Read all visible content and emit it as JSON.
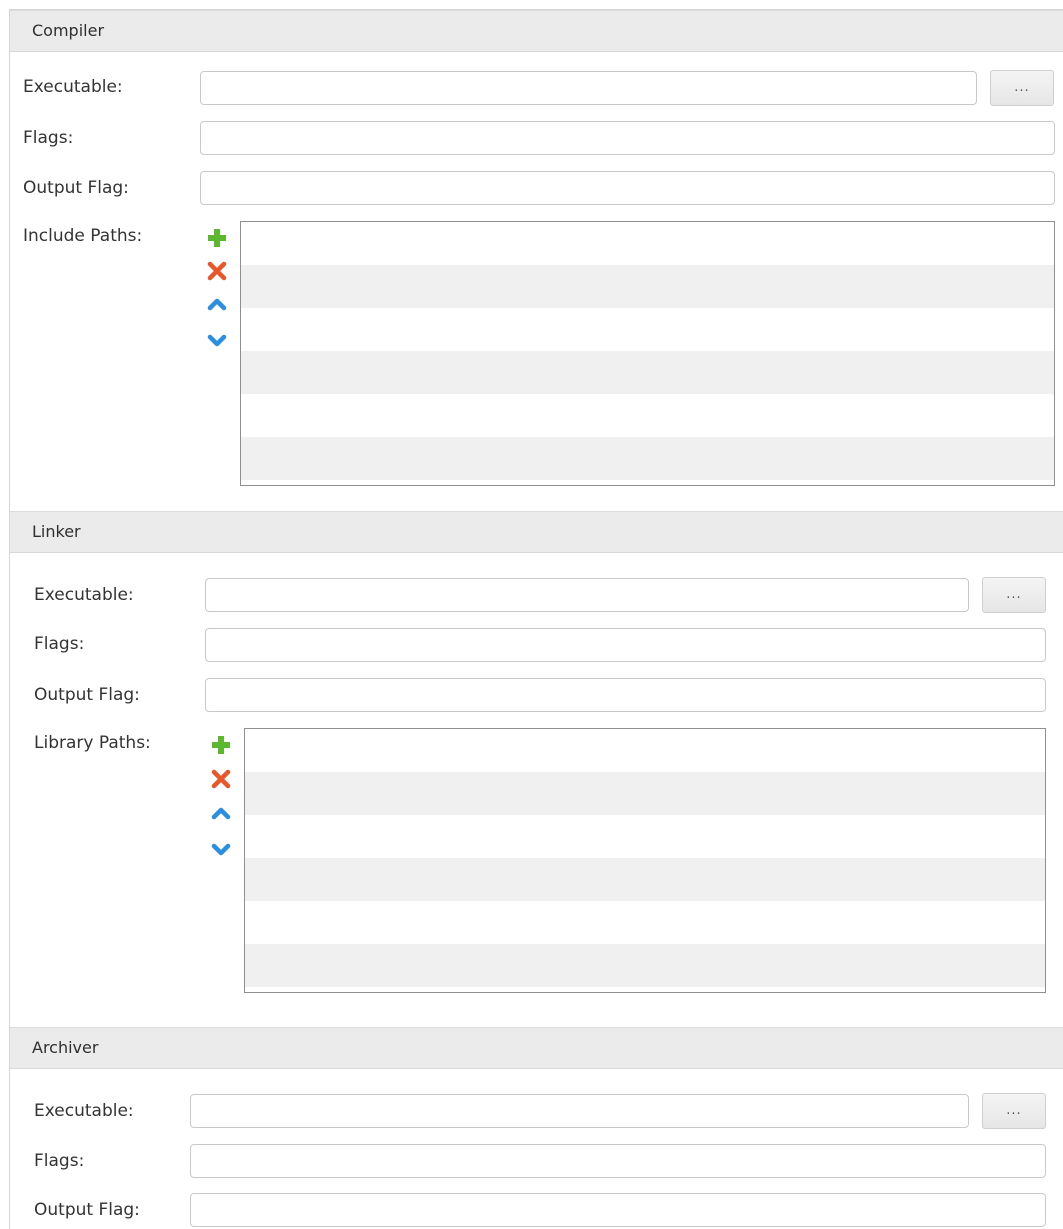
{
  "sections": {
    "compiler": {
      "title": "Compiler",
      "executable_label": "Executable:",
      "executable_value": "",
      "flags_label": "Flags:",
      "flags_value": "",
      "output_flag_label": "Output Flag:",
      "output_flag_value": "",
      "paths_label": "Include Paths:",
      "browse_label": "..."
    },
    "linker": {
      "title": "Linker",
      "executable_label": "Executable:",
      "executable_value": "",
      "flags_label": "Flags:",
      "flags_value": "",
      "output_flag_label": "Output Flag:",
      "output_flag_value": "",
      "paths_label": "Library Paths:",
      "browse_label": "..."
    },
    "archiver": {
      "title": "Archiver",
      "executable_label": "Executable:",
      "executable_value": "",
      "flags_label": "Flags:",
      "flags_value": "",
      "output_flag_label": "Output Flag:",
      "output_flag_value": "",
      "browse_label": "..."
    }
  },
  "icons": {
    "add": "plus-icon",
    "remove": "x-icon",
    "up": "chevron-up-icon",
    "down": "chevron-down-icon"
  },
  "colors": {
    "add_green": "#5cb82e",
    "remove_red": "#e8562a",
    "arrow_blue": "#2a8fe0",
    "header_bg": "#ebebeb",
    "list_stripe": "#f0f0f0"
  }
}
